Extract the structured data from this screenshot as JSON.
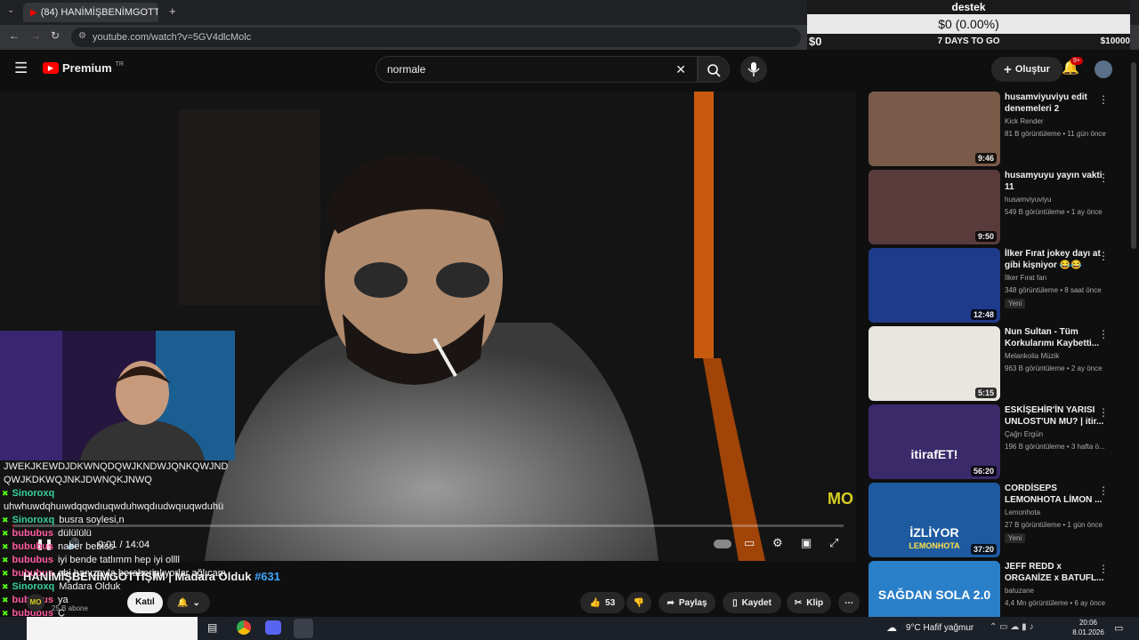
{
  "browser": {
    "tab_title": "(84) HANİMİŞBENİMGOTTİŞ",
    "url": "youtube.com/watch?v=5GV4dlcMolc"
  },
  "overlay": {
    "title": "destek",
    "bar_text": "$0 (0.00%)",
    "left_value": "$0",
    "days_left": "7 DAYS TO GO",
    "goal": "$10000"
  },
  "header": {
    "logo": "Premium",
    "logo_badge": "TR",
    "search_value": "normale",
    "create_label": "Oluştur",
    "notif_count": "9+"
  },
  "player": {
    "time": "0:01 / 14:04",
    "progress_pct": 0.12,
    "watermark": "MO"
  },
  "chat": {
    "lines": [
      {
        "name": "",
        "text": "JWEKJKEWDJDKWNQDQWJKNDWJQNKQWJND"
      },
      {
        "name": "",
        "text": "QWJKDKWQJNKJDWNQKJNWQ"
      },
      {
        "name": "Sinoroxq",
        "text": ""
      },
      {
        "name": "",
        "text": "uhwhuwdqhuıwdqqwdıuqwduhwqdıudwqıuqwduhü"
      },
      {
        "name": "Sinoroxq",
        "text": "busra soylesi,n"
      },
      {
        "name": "bububus",
        "text": "dülülülü"
      },
      {
        "name": "bububus",
        "text": "naber bebiss"
      },
      {
        "name": "bububus",
        "text": "iyi bende tatlımm hep iyi ollll"
      },
      {
        "name": "bububus",
        "text": "abi hanızayla beraberiplıyorlar ağlıcam"
      },
      {
        "name": "Sinoroxq",
        "text": "Madara Olduk"
      },
      {
        "name": "bububus",
        "text": "ya"
      },
      {
        "name": "bububus",
        "text": "Ç"
      }
    ]
  },
  "video": {
    "title": "HANİMİŞBENİMGOTTİŞİM | Madara Olduk",
    "hashtag": "#631",
    "subs": "25 B abone",
    "join_label": "Katıl",
    "likes": "53",
    "share_label": "Paylaş",
    "save_label": "Kaydet",
    "clip_label": "Klip"
  },
  "recommendations": [
    {
      "title": "husamviyuviyu edit denemeleri 2",
      "channel": "Kick Render",
      "meta": "81 B görüntüleme • 11 gün önce",
      "duration": "9:46",
      "badge": "",
      "color": "#7a5a48"
    },
    {
      "title": "husamyuyu yayın vakti 11",
      "channel": "husamviyuviyu",
      "meta": "549 B görüntüleme • 1 ay önce",
      "duration": "9:50",
      "badge": "",
      "color": "#5a3b3b"
    },
    {
      "title": "İlker Fırat jokey dayı at gibi kişniyor 😂😂",
      "channel": "İlker Fırat fan",
      "meta": "348 görüntüleme • 8 saat önce",
      "duration": "12:48",
      "badge": "Yeni",
      "color": "#1e3a8a"
    },
    {
      "title": "Nun Sultan - Tüm Korkularımı Kaybetti...",
      "channel": "Melankolia Müzik",
      "meta": "963 B görüntüleme • 2 ay önce",
      "duration": "5:15",
      "badge": "",
      "color": "#e9e6df"
    },
    {
      "title": "ESKİŞEHİR'İN YARISI UNLOST'UN MU? | itir...",
      "channel": "Çağrı Ergün",
      "meta": "196 B görüntüleme • 3 hafta ö...",
      "duration": "56:20",
      "badge": "",
      "color": "#3b2a6a"
    },
    {
      "title": "CORDİSEPS LEMONHOTA LİMON ...",
      "channel": "Lemonhota",
      "meta": "27 B görüntüleme • 1 gün önce",
      "duration": "37:20",
      "badge": "Yeni",
      "color": "#1e5aa0"
    },
    {
      "title": "JEFF REDD x ORGANİZE x BATUFL...",
      "channel": "batuzane",
      "meta": "4,4 Mn görüntüleme • 6 ay önce",
      "duration": "",
      "badge": "",
      "color": "#2a7fc9"
    }
  ],
  "rec_overlays": [
    "İZLİYOR",
    "LEMONHOTA",
    "itirafET!",
    "SAĞDAN SOLA 2.0"
  ],
  "taskbar": {
    "weather": "9°C  Hafif yağmur",
    "time": "20:06",
    "date": "8.01.2026"
  }
}
